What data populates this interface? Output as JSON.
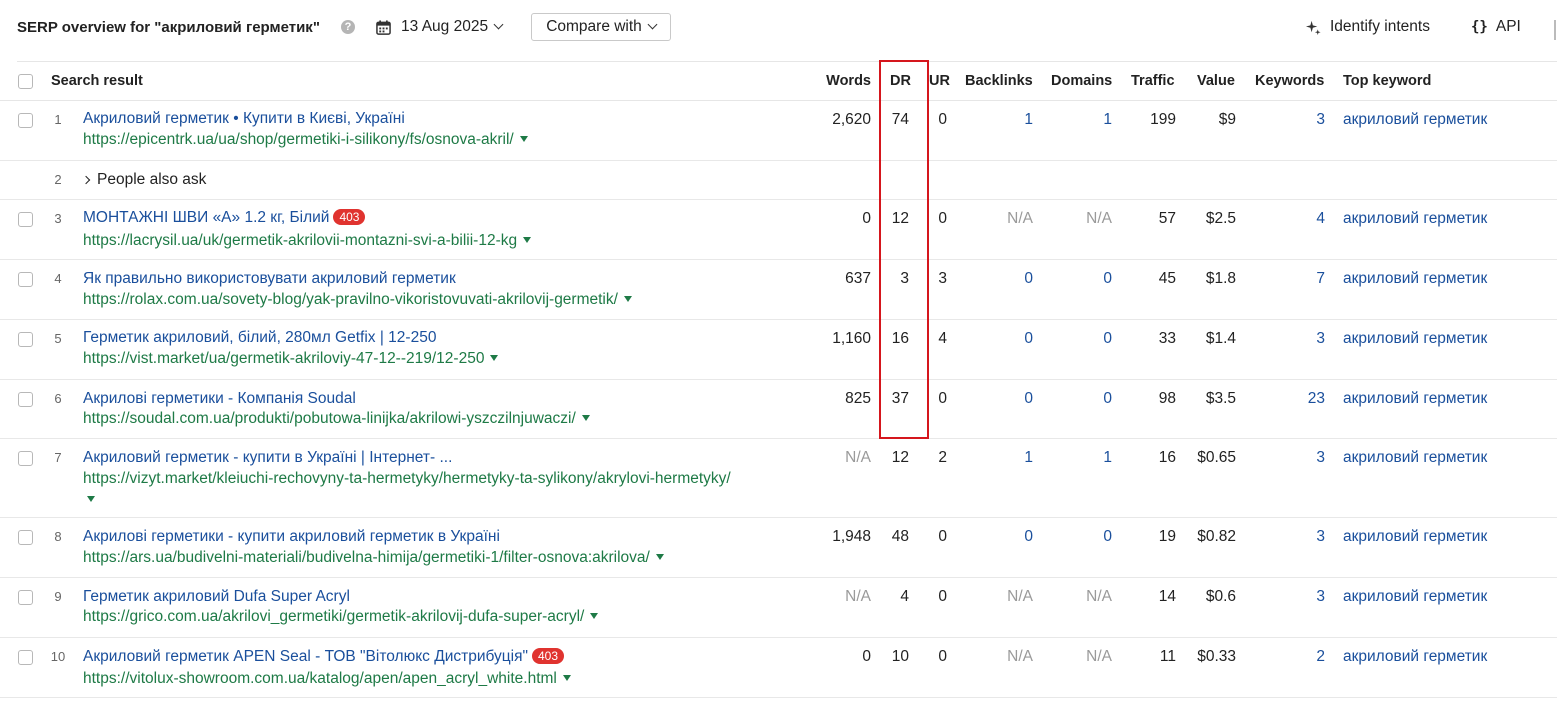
{
  "header": {
    "title": "SERP overview for \"акриловий герметик\"",
    "help_icon": "?",
    "date": "13 Aug 2025",
    "compare_label": "Compare with",
    "identify_intents_label": "Identify intents",
    "api_label": "API",
    "api_icon": "{}"
  },
  "columns": {
    "search_result": "Search result",
    "words": "Words",
    "dr": "DR",
    "ur": "UR",
    "backlinks": "Backlinks",
    "domains": "Domains",
    "traffic": "Traffic",
    "value": "Value",
    "keywords": "Keywords",
    "top_keyword": "Top keyword"
  },
  "paa": {
    "position": "2",
    "label": "People also ask"
  },
  "rows": [
    {
      "position": "1",
      "title": "Акриловий герметик • Купити в Києві, Україні",
      "badge": "",
      "url": "https://epicentrk.ua/ua/shop/germetiki-i-silikony/fs/osnova-akril/",
      "words": "2,620",
      "dr": "74",
      "ur": "0",
      "backlinks": "1",
      "domains": "1",
      "traffic": "199",
      "value": "$9",
      "keywords": "3",
      "top_keyword": "акриловий герметик"
    },
    {
      "position": "3",
      "title": "МОНТАЖНІ ШВИ «А» 1.2 кг, Білий",
      "badge": "403",
      "url": "https://lacrysil.ua/uk/germetik-akrilovii-montazni-svi-a-bilii-12-kg",
      "words": "0",
      "dr": "12",
      "ur": "0",
      "backlinks": "N/A",
      "domains": "N/A",
      "traffic": "57",
      "value": "$2.5",
      "keywords": "4",
      "top_keyword": "акриловий герметик"
    },
    {
      "position": "4",
      "title": "Як правильно використовувати акриловий герметик",
      "badge": "",
      "url": "https://rolax.com.ua/sovety-blog/yak-pravilno-vikoristovuvati-akrilovij-germetik/",
      "words": "637",
      "dr": "3",
      "ur": "3",
      "backlinks": "0",
      "domains": "0",
      "traffic": "45",
      "value": "$1.8",
      "keywords": "7",
      "top_keyword": "акриловий герметик"
    },
    {
      "position": "5",
      "title": "Герметик акриловий, білий, 280мл Getfix | 12-250",
      "badge": "",
      "url": "https://vist.market/ua/germetik-akriloviy-47-12--219/12-250",
      "words": "1,160",
      "dr": "16",
      "ur": "4",
      "backlinks": "0",
      "domains": "0",
      "traffic": "33",
      "value": "$1.4",
      "keywords": "3",
      "top_keyword": "акриловий герметик"
    },
    {
      "position": "6",
      "title": "Акрилові герметики - Компанія Soudal",
      "badge": "",
      "url": "https://soudal.com.ua/produkti/pobutowa-linijka/akrilowi-yszczilnjuwaczi/",
      "words": "825",
      "dr": "37",
      "ur": "0",
      "backlinks": "0",
      "domains": "0",
      "traffic": "98",
      "value": "$3.5",
      "keywords": "23",
      "top_keyword": "акриловий герметик"
    },
    {
      "position": "7",
      "title": "Акриловий герметик - купити в Україні | Інтернет- ...",
      "badge": "",
      "url": "https://vizyt.market/kleiuchi-rechovyny-ta-hermetyky/hermetyky-ta-sylikony/akrylovi-hermetyky/",
      "words": "N/A",
      "dr": "12",
      "ur": "2",
      "backlinks": "1",
      "domains": "1",
      "traffic": "16",
      "value": "$0.65",
      "keywords": "3",
      "top_keyword": "акриловий герметик"
    },
    {
      "position": "8",
      "title": "Акрилові герметики - купити акриловий герметик в Україні",
      "badge": "",
      "url": "https://ars.ua/budivelni-materiali/budivelna-himija/germetiki-1/filter-osnova:akrilova/",
      "words": "1,948",
      "dr": "48",
      "ur": "0",
      "backlinks": "0",
      "domains": "0",
      "traffic": "19",
      "value": "$0.82",
      "keywords": "3",
      "top_keyword": "акриловий герметик"
    },
    {
      "position": "9",
      "title": "Герметик акриловий Dufa Super Acryl",
      "badge": "",
      "url": "https://grico.com.ua/akrilovi_germetiki/germetik-akrilovij-dufa-super-acryl/",
      "words": "N/A",
      "dr": "4",
      "ur": "0",
      "backlinks": "N/A",
      "domains": "N/A",
      "traffic": "14",
      "value": "$0.6",
      "keywords": "3",
      "top_keyword": "акриловий герметик"
    },
    {
      "position": "10",
      "title": "Акриловий герметик APEN Seal - ТОВ \"Вітолюкс Дистрибуція\"",
      "badge": "403",
      "url": "https://vitolux-showroom.com.ua/katalog/apen/apen_acryl_white.html",
      "words": "0",
      "dr": "10",
      "ur": "0",
      "backlinks": "N/A",
      "domains": "N/A",
      "traffic": "11",
      "value": "$0.33",
      "keywords": "2",
      "top_keyword": "акриловий герметик"
    }
  ]
}
